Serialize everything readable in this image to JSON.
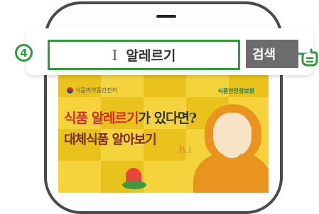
{
  "step": {
    "number": "4"
  },
  "search": {
    "query": "알레르기",
    "button_label": "검색"
  },
  "banner": {
    "org_left": "식품의약품안전처",
    "org_right": "식품안전정보원",
    "headline_red": "식품 알레르기",
    "headline_dark": "가 있다면?",
    "subhead": "대체식품 알아보기",
    "sneeze": "h.i"
  },
  "colors": {
    "accent_green": "#2e9b3e",
    "button_gray": "#6c6c6c",
    "banner_yellow": "#f5d33d"
  }
}
